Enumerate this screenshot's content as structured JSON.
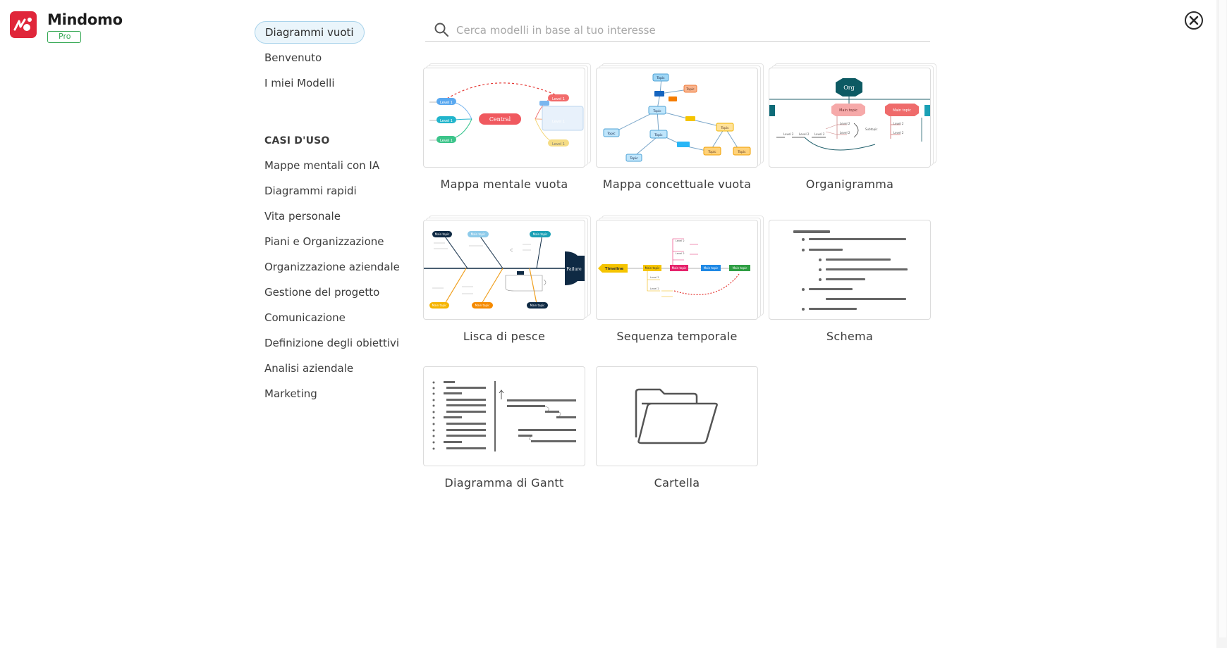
{
  "app": {
    "name": "Mindomo",
    "plan": "Pro"
  },
  "search": {
    "placeholder": "Cerca modelli in base al tuo interesse"
  },
  "nav": {
    "primary": [
      "Diagrammi vuoti",
      "Benvenuto",
      "I miei Modelli"
    ],
    "section_title": "CASI D'USO",
    "use_cases": [
      "Mappe mentali con IA",
      "Diagrammi rapidi",
      "Vita personale",
      "Piani e Organizzazione",
      "Organizzazione aziendale",
      "Gestione del progetto",
      "Comunicazione",
      "Definizione degli obiettivi",
      "Analisi aziendale",
      "Marketing"
    ]
  },
  "templates": [
    {
      "label": "Mappa mentale vuota",
      "icon": "mind-map-preview"
    },
    {
      "label": "Mappa concettuale vuota",
      "icon": "concept-map-preview"
    },
    {
      "label": "Organigramma",
      "icon": "org-chart-preview"
    },
    {
      "label": "Lisca di pesce",
      "icon": "fishbone-preview"
    },
    {
      "label": "Sequenza temporale",
      "icon": "timeline-preview"
    },
    {
      "label": "Schema",
      "icon": "outline-preview"
    },
    {
      "label": "Diagramma di Gantt",
      "icon": "gantt-preview"
    },
    {
      "label": "Cartella",
      "icon": "folder-icon"
    }
  ],
  "preview_text": {
    "central": "Central",
    "level": "Level 1",
    "level2": "Level 2",
    "topic": "Topic",
    "org": "Org",
    "main_topic": "Main topic",
    "subtopic": "Subtopic",
    "failure": "Failure",
    "timeline": "Timeline"
  },
  "colors": {
    "accent_blue": "#a9d3eb",
    "pro_green": "#34a853",
    "brand_red": "#e0263a"
  }
}
